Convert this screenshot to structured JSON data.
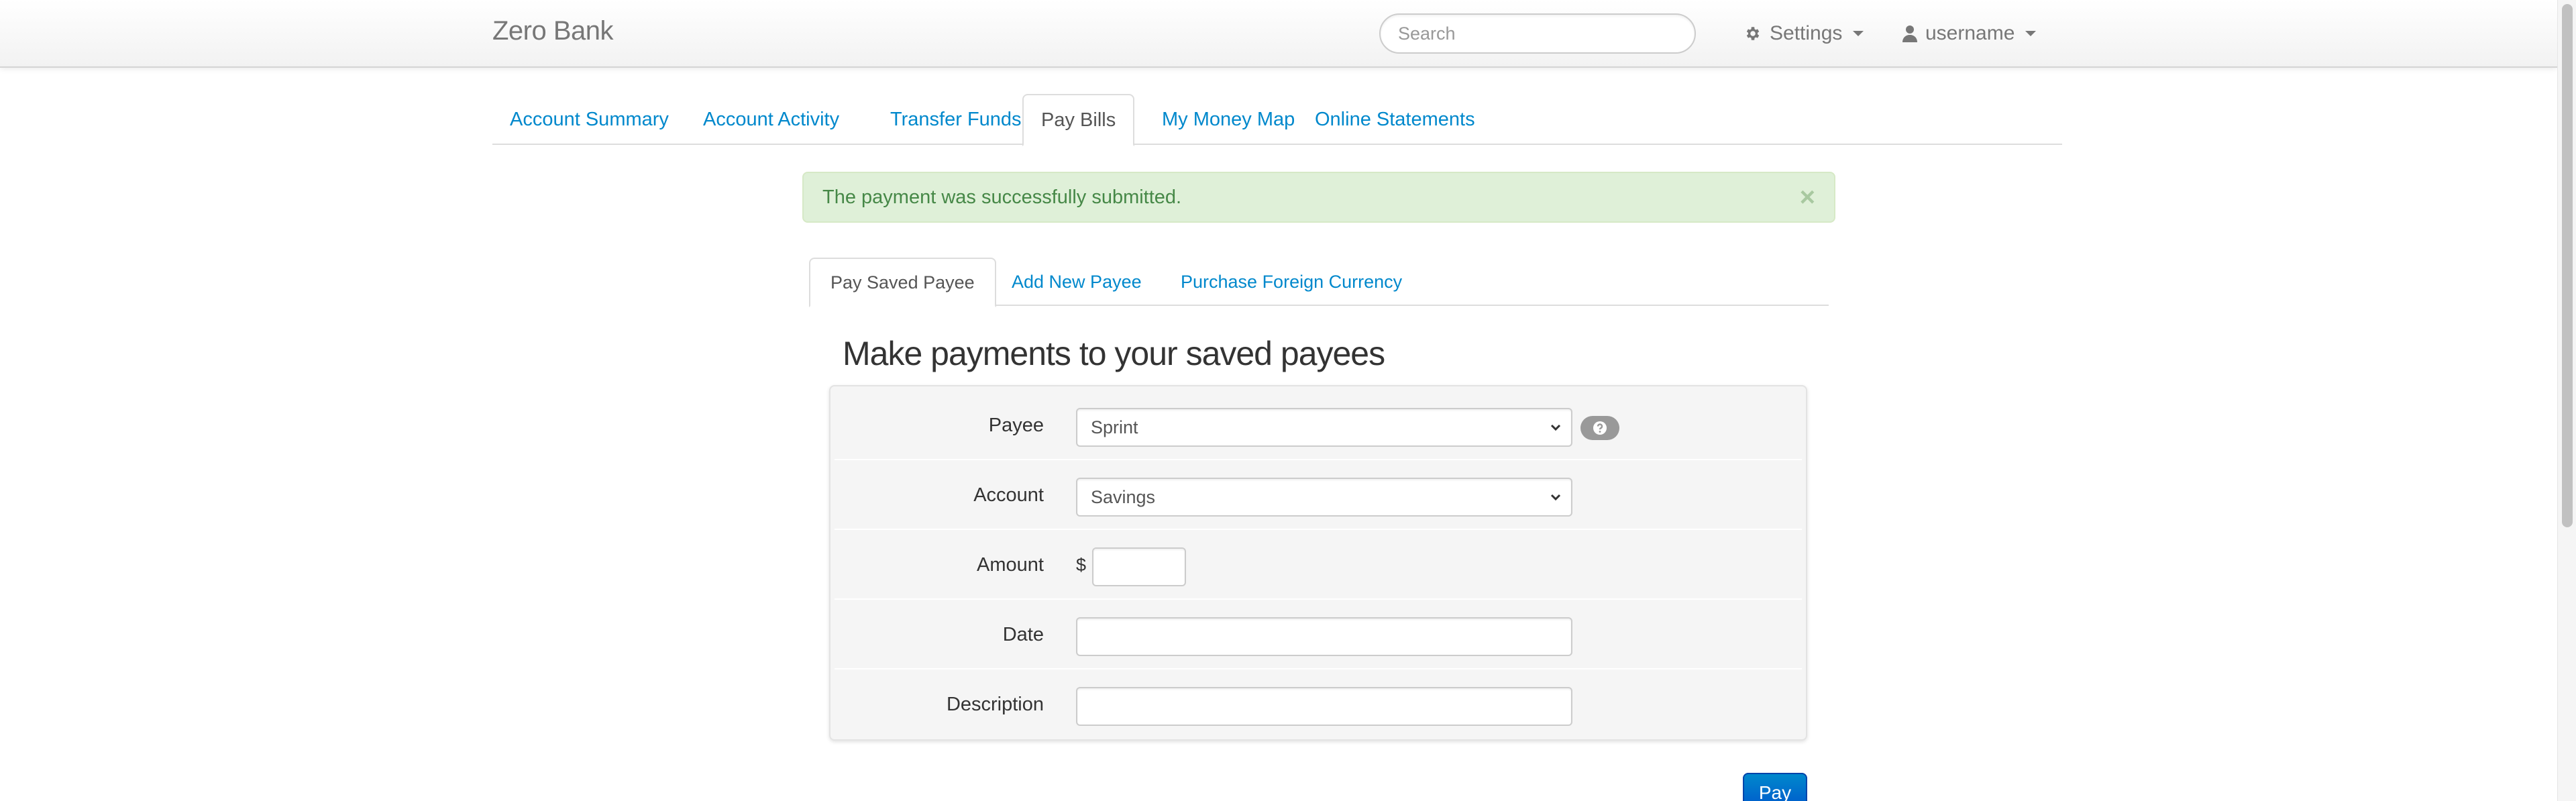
{
  "navbar": {
    "brand": "Zero Bank",
    "search_placeholder": "Search",
    "settings_label": "Settings",
    "user_label": "username"
  },
  "main_tabs": [
    {
      "label": "Account Summary",
      "active": false
    },
    {
      "label": "Account Activity",
      "active": false
    },
    {
      "label": "Transfer Funds",
      "active": false
    },
    {
      "label": "Pay Bills",
      "active": true
    },
    {
      "label": "My Money Map",
      "active": false
    },
    {
      "label": "Online Statements",
      "active": false
    }
  ],
  "alert": {
    "message": "The payment was successfully submitted.",
    "close_glyph": "×"
  },
  "sub_tabs": [
    {
      "label": "Pay Saved Payee",
      "active": true
    },
    {
      "label": "Add New Payee",
      "active": false
    },
    {
      "label": "Purchase Foreign Currency",
      "active": false
    }
  ],
  "section_title": "Make payments to your saved payees",
  "form": {
    "payee_label": "Payee",
    "payee_value": "Sprint",
    "account_label": "Account",
    "account_value": "Savings",
    "amount_label": "Amount",
    "currency_symbol": "$",
    "amount_value": "",
    "date_label": "Date",
    "date_value": "",
    "description_label": "Description",
    "description_value": ""
  },
  "pay_button_label": "Pay",
  "icons": {
    "settings": "gear-icon",
    "user": "user-icon",
    "help": "question-circle-icon",
    "select": "chevron-down-icon"
  },
  "colors": {
    "link": "#0088cc",
    "alert_bg": "#dff0d8",
    "alert_text": "#468847",
    "primary_button": "#0055cc"
  }
}
